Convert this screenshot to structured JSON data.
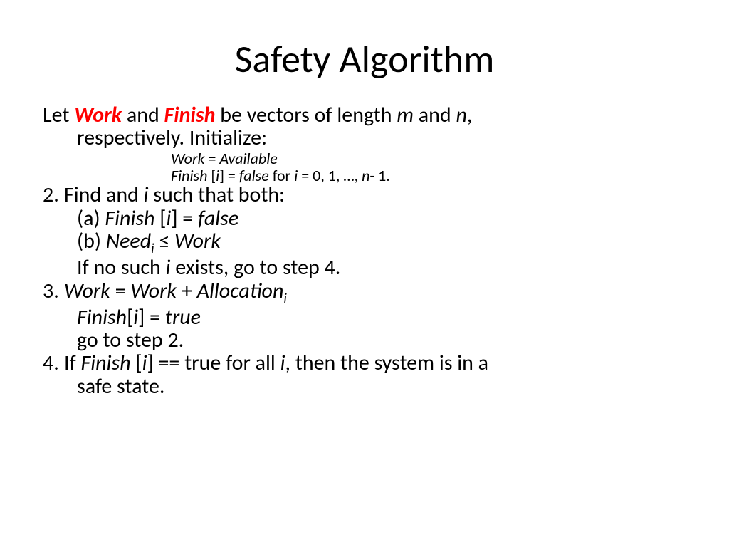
{
  "title": "Safety Algorithm",
  "s1": {
    "let": "Let ",
    "work": "Work",
    "and": " and ",
    "finish": "Finish",
    "rest1": " be vectors of length ",
    "m": "m",
    "and2": " and ",
    "n": "n",
    "comma": ",",
    "rest2": "respectively.  Initialize:",
    "init1a": "Work",
    "init1b": " = ",
    "init1c": "Available",
    "init2a": "Finish ",
    "init2b": "[",
    "init2c": "i",
    "init2d": "] = ",
    "init2e": "false",
    "init2f": " for ",
    "init2g": "i",
    "init2h": " = 0, 1, …, ",
    "init2i": "n",
    "init2j": "- 1."
  },
  "s2": {
    "num": "2.",
    "a": "Find and ",
    "i": "i",
    "b": " such that both:",
    "pa_a": "(a) ",
    "pa_finish": "Finish ",
    "pa_br1": "[",
    "pa_i": "i",
    "pa_br2": "] = ",
    "pa_false": "false",
    "pb_a": "(b) ",
    "pb_need": "Need",
    "pb_sub": "i",
    "pb_le": " ≤ ",
    "pb_work": "Work",
    "c1": "If no such ",
    "c2": "i",
    "c3": " exists, go to step 4."
  },
  "s3": {
    "num": "3.",
    "a1": "Work",
    "a2": " = ",
    "a3": "Work",
    "a4": " + ",
    "a5": "Allocation",
    "a6": "i",
    "b1": "Finish",
    "b2": "[",
    "b3": "i",
    "b4": "] = ",
    "b5": "true",
    "c": "go to step 2."
  },
  "s4": {
    "num": "4.",
    "a": "If ",
    "finish": "Finish ",
    "br1": "[",
    "i": "i",
    "br2": "] == true for all ",
    "i2": "i",
    "b": ", then the system is in a",
    "c": "safe state."
  }
}
